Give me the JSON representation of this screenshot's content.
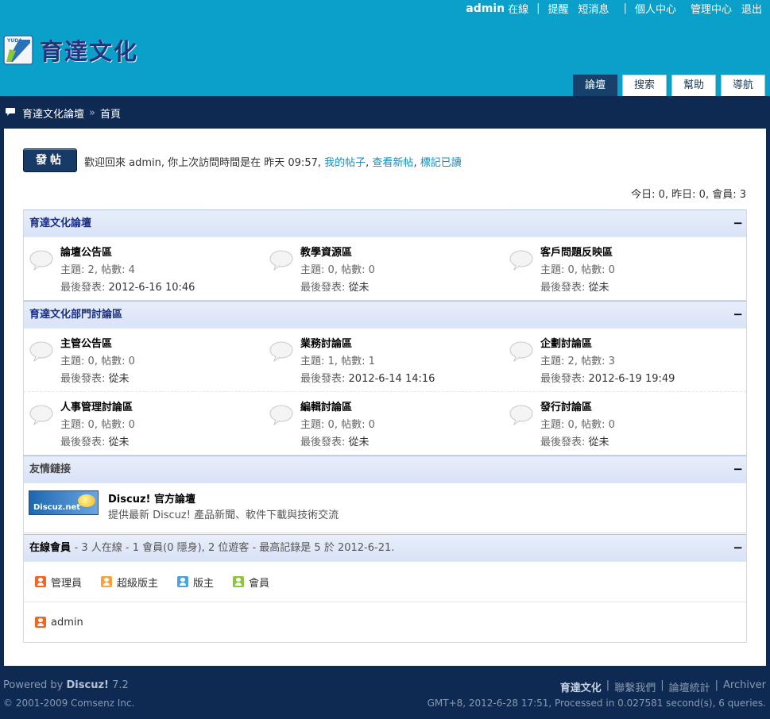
{
  "header": {
    "username": "admin",
    "status": "在線",
    "links": [
      "提醒",
      "短消息",
      "個人中心",
      "管理中心",
      "退出"
    ],
    "site_name": "育達文化",
    "logo_tag": "YUDA",
    "tabs": [
      "論壇",
      "搜索",
      "幫助",
      "導航"
    ]
  },
  "breadcrumb": {
    "forum": "育達文化論壇",
    "sep": "»",
    "page": "首頁"
  },
  "welcome": {
    "post_button": "發帖",
    "text": "歡迎回來 admin, 你上次訪問時間是在 昨天 09:57,",
    "my_posts": "我的帖子",
    "new_posts": "查看新帖",
    "mark_read": "標記已讀",
    "stats": "今日: 0, 昨日: 0, 會員: 3"
  },
  "labels": {
    "topics": "主題:",
    "posts": "帖數:",
    "last_post": "最後發表:",
    "collapse": "−"
  },
  "categories": [
    {
      "title": "育達文化論壇",
      "rows": [
        [
          {
            "name": "論壇公告區",
            "topics": "2",
            "posts": "4",
            "last": "2012-6-16 10:46"
          },
          {
            "name": "教學資源區",
            "topics": "0",
            "posts": "0",
            "last": "從未"
          },
          {
            "name": "客戶問題反映區",
            "topics": "0",
            "posts": "0",
            "last": "從未"
          }
        ]
      ]
    },
    {
      "title": "育達文化部門討論區",
      "rows": [
        [
          {
            "name": "主管公告區",
            "topics": "0",
            "posts": "0",
            "last": "從未"
          },
          {
            "name": "業務討論區",
            "topics": "1",
            "posts": "1",
            "last": "2012-6-14 14:16"
          },
          {
            "name": "企劃討論區",
            "topics": "2",
            "posts": "3",
            "last": "2012-6-19 19:49"
          }
        ],
        [
          {
            "name": "人事管理討論區",
            "topics": "0",
            "posts": "0",
            "last": "從未"
          },
          {
            "name": "編輯討論區",
            "topics": "0",
            "posts": "0",
            "last": "從未"
          },
          {
            "name": "發行討論區",
            "topics": "0",
            "posts": "0",
            "last": "從未"
          }
        ]
      ]
    }
  ],
  "links_section": {
    "title": "友情鏈接",
    "logo_text": "Discuz.net",
    "name": "Discuz! 官方論壇",
    "desc": "提供最新 Discuz! 產品新聞、軟件下載與技術交流"
  },
  "online": {
    "title": "在線會員",
    "summary": "- 3 人在線 - 1 會員(0 隱身), 2 位遊客 - 最高記錄是 5 於 2012-6-21.",
    "legend": [
      {
        "label": "管理員",
        "color": "#f26522"
      },
      {
        "label": "超級版主",
        "color": "#f7a23b"
      },
      {
        "label": "版主",
        "color": "#4aa3df"
      },
      {
        "label": "會員",
        "color": "#8cc63f"
      }
    ],
    "users": [
      {
        "name": "admin",
        "color": "#f26522"
      }
    ]
  },
  "footer": {
    "powered": "Powered by",
    "product": "Discuz!",
    "version": "7.2",
    "copyright": "© 2001-2009 Comsenz Inc.",
    "brand": "育達文化",
    "links": [
      "聯繫我們",
      "論壇統計",
      "Archiver"
    ],
    "timing": "GMT+8, 2012-6-28 17:51, Processed in 0.027581 second(s), 6 queries."
  }
}
